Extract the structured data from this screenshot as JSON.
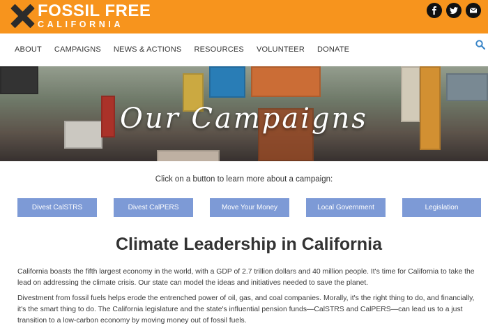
{
  "header": {
    "logo_line1": "FOSSIL FREE",
    "logo_line2": "CALIFORNIA",
    "brand_color": "#f7941d",
    "socials": [
      "facebook-icon",
      "twitter-icon",
      "email-icon"
    ]
  },
  "nav": {
    "items": [
      {
        "label": "ABOUT"
      },
      {
        "label": "CAMPAIGNS"
      },
      {
        "label": "NEWS & ACTIONS"
      },
      {
        "label": "RESOURCES"
      },
      {
        "label": "VOLUNTEER"
      },
      {
        "label": "DONATE"
      }
    ],
    "search_icon": "search-icon"
  },
  "banner": {
    "title": "Our Campaigns"
  },
  "main": {
    "intro": "Click on a button to learn more about a campaign:",
    "buttons": [
      {
        "label": "Divest CalSTRS"
      },
      {
        "label": "Divest CalPERS"
      },
      {
        "label": "Move Your Money"
      },
      {
        "label": "Local Government"
      },
      {
        "label": "Legislation"
      }
    ],
    "button_color": "#7d9ad6",
    "heading": "Climate Leadership in California",
    "paragraph1": "California boasts the fifth largest economy in the world, with a GDP of 2.7 trillion dollars and 40 million people. It's time for California to take the lead on addressing the climate crisis. Our state can model the ideas and initiatives needed to save the planet.",
    "paragraph2": "Divestment from fossil fuels helps erode the entrenched power of oil, gas, and coal companies. Morally, it's the right thing to do, and financially, it's the smart thing to do. The California legislature and the state's influential pension funds—CalSTRS and CalPERS—can lead us to a just transition to a low-carbon economy by moving money out of fossil fuels."
  }
}
